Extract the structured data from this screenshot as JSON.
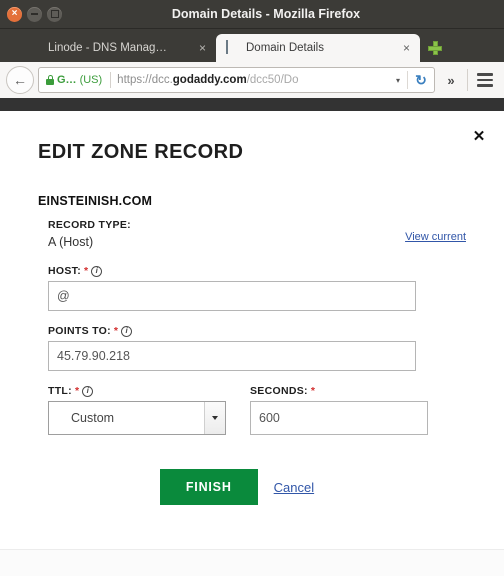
{
  "window": {
    "title": "Domain Details - Mozilla Firefox",
    "close_glyph": "×",
    "minimize_glyph": "",
    "maximize_glyph": ""
  },
  "tabs": [
    {
      "label": "Linode - DNS Manag…",
      "favicon": "cube-icon",
      "close_glyph": "×",
      "active": false
    },
    {
      "label": "Domain Details",
      "favicon": "page-icon",
      "close_glyph": "×",
      "active": true
    }
  ],
  "newtab_label": "+",
  "toolbar": {
    "back_glyph": "←",
    "identity_org": "G…",
    "identity_country": "(US)",
    "url_scheme": "https://dcc.",
    "url_host": "godaddy.com",
    "url_path": "/dcc50/Do",
    "dropdown_glyph": "▾",
    "reload_glyph": "↻",
    "overflow_glyph": "»",
    "menu_label": "menu"
  },
  "modal": {
    "close_glyph": "✕",
    "title": "EDIT ZONE RECORD",
    "domain": "EINSTEINISH.COM",
    "record_type_label": "RECORD TYPE:",
    "record_type_value": "A (Host)",
    "view_current_label": "View current",
    "fields": {
      "host": {
        "label": "HOST:",
        "required_mark": "*",
        "info_glyph": "i",
        "value": "@"
      },
      "points_to": {
        "label": "POINTS TO:",
        "required_mark": "*",
        "info_glyph": "i",
        "value": "45.79.90.218"
      },
      "ttl": {
        "label": "TTL:",
        "required_mark": "*",
        "info_glyph": "i",
        "value": "Custom"
      },
      "seconds": {
        "label": "SECONDS:",
        "required_mark": "*",
        "value": "600"
      }
    },
    "finish_label": "FINISH",
    "cancel_label": "Cancel"
  },
  "colors": {
    "accent_green": "#0a8a3c",
    "link_blue": "#3156a8",
    "required_red": "#d32f2f",
    "chrome_dark": "#3c3b37",
    "site_nav": "#333333"
  }
}
